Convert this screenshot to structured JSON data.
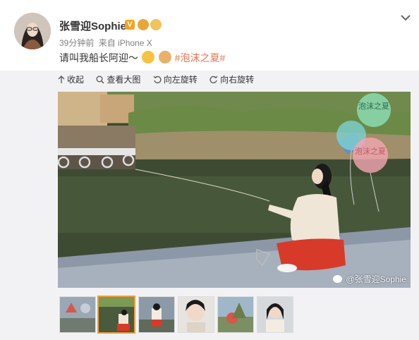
{
  "post": {
    "username": "张雪迎Sophie",
    "verified_badge": "V",
    "timestamp": "39分钟前",
    "source": "来自 iPhone X",
    "text_main": "请叫我船长阿迎～",
    "hashtag": "#泡沫之夏#"
  },
  "toolbar": {
    "collapse": "收起",
    "view_large": "查看大图",
    "rotate_left": "向左旋转",
    "rotate_right": "向右旋转"
  },
  "photo": {
    "watermark": "@张雪迎Sophie",
    "balloon_text_1": "泡沫之夏",
    "balloon_text_2": "泡沫之夏"
  },
  "thumbnails": {
    "count": 6,
    "selected_index": 1
  },
  "colors": {
    "hashtag": "#eb7350",
    "badge": "#f7a21b",
    "selected_border": "#f29c38",
    "panel_bg": "#f2f2f5"
  },
  "icons": [
    "chevron-down-icon",
    "collapse-arrow-icon",
    "zoom-icon",
    "rotate-left-icon",
    "rotate-right-icon",
    "weibo-logo-icon"
  ]
}
